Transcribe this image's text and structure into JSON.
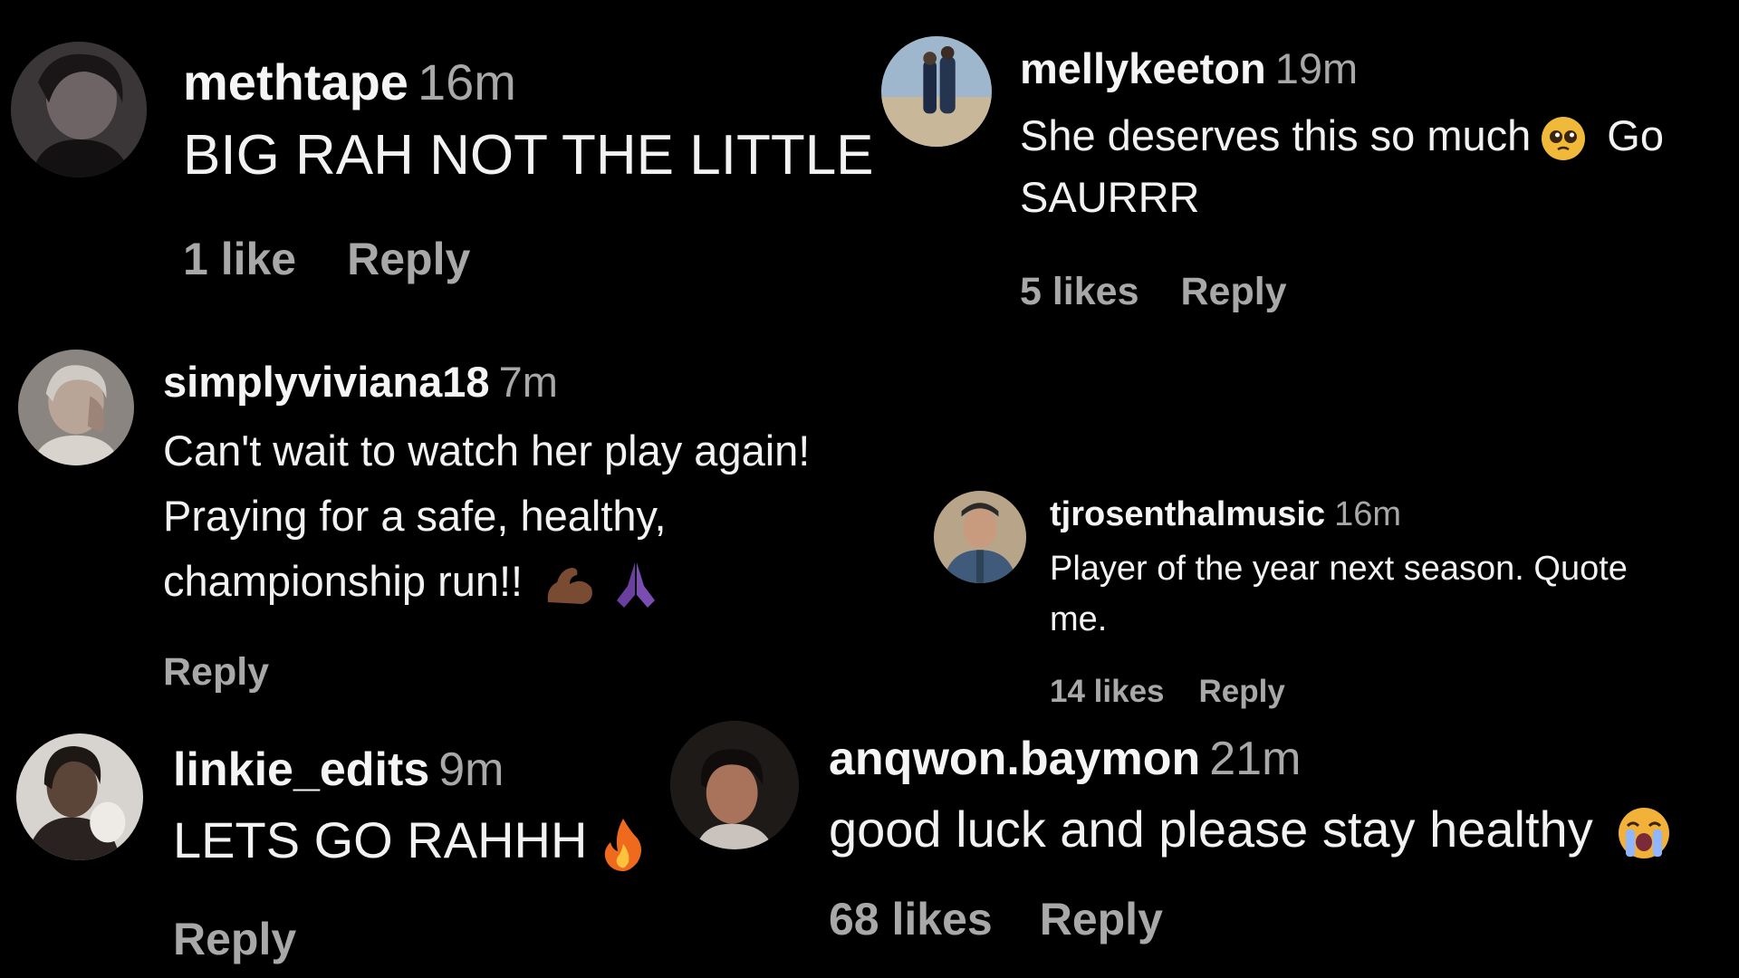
{
  "comments": [
    {
      "user": "methtape",
      "time": "16m",
      "text": "BIG RAH NOT THE LITTLE",
      "likes": "1 like",
      "reply": "Reply"
    },
    {
      "user": "mellykeeton",
      "time": "19m",
      "text_line1": "She deserves this so much",
      "text_line1_tail": "Go",
      "text_line2": "SAURRR",
      "likes": "5 likes",
      "reply": "Reply"
    },
    {
      "user": "simplyviviana18",
      "time": "7m",
      "text_line1": "Can't wait to watch her play again!",
      "text_line2": "Praying for a safe, healthy,",
      "text_line3": "championship run!!",
      "reply": "Reply"
    },
    {
      "user": "tjrosenthalmusic",
      "time": "16m",
      "text_line1": "Player of the year next season. Quote",
      "text_line2": "me.",
      "likes": "14 likes",
      "reply": "Reply"
    },
    {
      "user": "linkie_edits",
      "time": "9m",
      "text": "LETS GO RAHHH",
      "reply": "Reply"
    },
    {
      "user": "anqwon.baymon",
      "time": "21m",
      "text": "good luck and please stay healthy",
      "likes": "68 likes",
      "reply": "Reply"
    }
  ],
  "icons": {
    "pleading_face": "pleading-face-icon",
    "flexed_bicep": "flexed-biceps-icon",
    "praying_hands": "folded-hands-icon",
    "fire": "fire-icon",
    "crying_face": "loudly-crying-face-icon"
  },
  "colors": {
    "background": "#000000",
    "username": "#f5f5f5",
    "secondary": "#a8a8a8",
    "text": "#f2f2f2"
  }
}
